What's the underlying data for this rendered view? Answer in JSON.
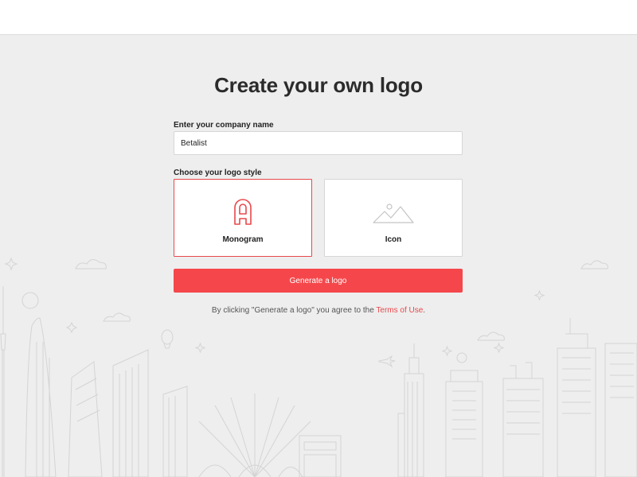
{
  "page": {
    "title": "Create your own logo"
  },
  "form": {
    "company_label": "Enter your company name",
    "company_value": "Betalist",
    "style_label": "Choose your logo style",
    "styles": [
      {
        "label": "Monogram",
        "icon": "monogram-a-icon",
        "selected": true
      },
      {
        "label": "Icon",
        "icon": "mountain-landscape-icon",
        "selected": false
      }
    ],
    "generate_label": "Generate a logo",
    "terms_prefix": "By clicking \"Generate a logo\" you agree to the ",
    "terms_link": "Terms of Use",
    "terms_suffix": "."
  },
  "colors": {
    "accent": "#f5474b",
    "selected_border": "#e8484b",
    "background": "#eeeeee",
    "skyline_stroke": "#d3d3d3"
  }
}
